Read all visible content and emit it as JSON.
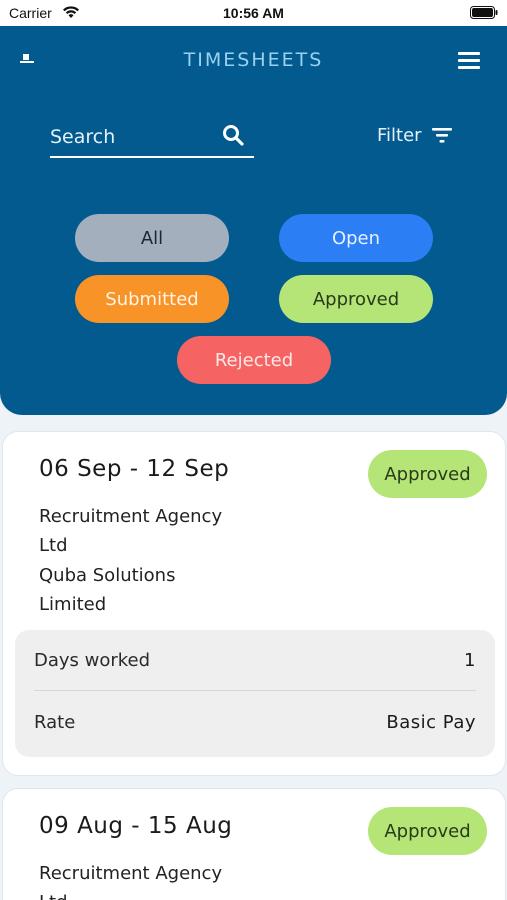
{
  "status_bar": {
    "carrier": "Carrier",
    "time": "10:56 AM"
  },
  "header": {
    "title": "TIMESHEETS",
    "search_placeholder": "Search",
    "filter_label": "Filter",
    "background_color": "#025a8f"
  },
  "chips": {
    "all": "All",
    "open": "Open",
    "submitted": "Submitted",
    "approved": "Approved",
    "rejected": "Rejected"
  },
  "timesheets": [
    {
      "dates": "06 Sep - 12 Sep",
      "status": "Approved",
      "lines": [
        "Recruitment Agency",
        "Ltd",
        "Quba Solutions",
        "Limited"
      ],
      "days_worked_label": "Days worked",
      "days_worked_value": "1",
      "rate_label": "Rate",
      "rate_value": "Basic Pay"
    },
    {
      "dates": "09 Aug - 15 Aug",
      "status": "Approved",
      "lines": [
        "Recruitment Agency",
        "Ltd"
      ]
    }
  ]
}
